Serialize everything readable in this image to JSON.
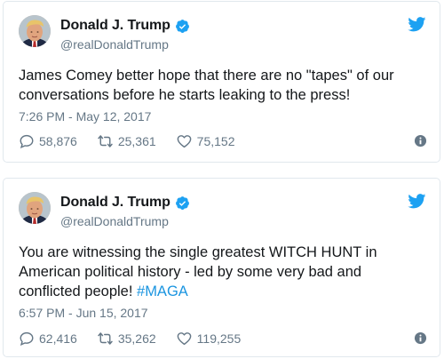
{
  "tweets": [
    {
      "author": {
        "display_name": "Donald J. Trump",
        "handle": "@realDonaldTrump"
      },
      "text": "James Comey better hope that there are no \"tapes\" of our conversations before he starts leaking to the press!",
      "hashtag": "",
      "timestamp": "7:26 PM - May 12, 2017",
      "replies": "58,876",
      "retweets": "25,361",
      "likes": "75,152"
    },
    {
      "author": {
        "display_name": "Donald J. Trump",
        "handle": "@realDonaldTrump"
      },
      "text": "You are witnessing the single greatest WITCH HUNT in American political history - led by some very bad and conflicted people! ",
      "hashtag": "#MAGA",
      "timestamp": "6:57 PM - Jun 15, 2017",
      "replies": "62,416",
      "retweets": "35,262",
      "likes": "119,255"
    }
  ],
  "icons": {
    "avatar": "avatar-photo",
    "verified": "verified-badge-icon",
    "brand": "twitter-bird-icon",
    "reply": "reply-icon",
    "retweet": "retweet-icon",
    "like": "heart-icon",
    "info": "info-icon"
  },
  "colors": {
    "brand": "#1da1f2",
    "verified": "#1da1f2",
    "hashtag": "#1b95e0",
    "secondary_text": "#657786",
    "border": "#e1e8ed"
  }
}
